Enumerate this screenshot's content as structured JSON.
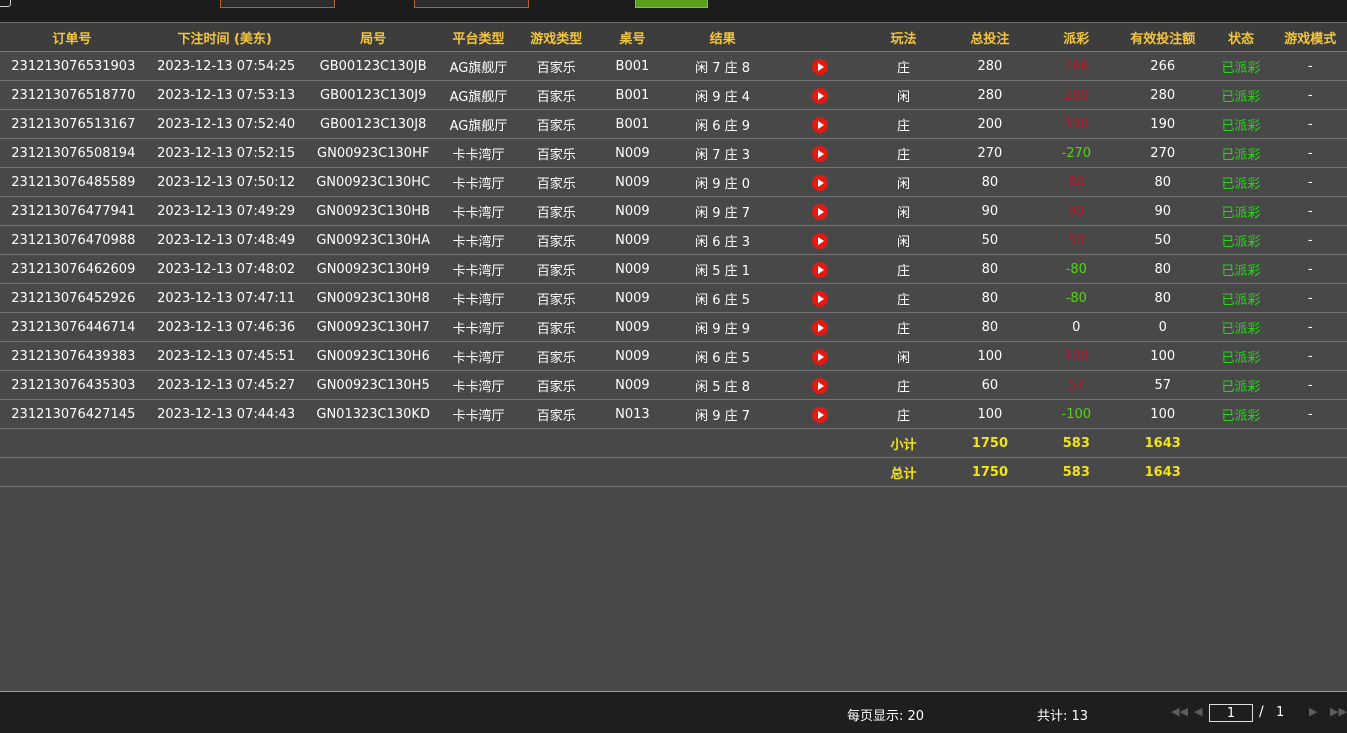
{
  "columns": [
    "订单号",
    "下注时间 (美东)",
    "局号",
    "平台类型",
    "游戏类型",
    "桌号",
    "结果",
    "",
    "玩法",
    "总投注",
    "派彩",
    "有效投注额",
    "状态",
    "游戏模式"
  ],
  "rows": [
    {
      "order": "231213076531903",
      "time": "2023-12-13 07:54:25",
      "round": "GB00123C130JB",
      "platform": "AG旗舰厅",
      "game": "百家乐",
      "table": "B001",
      "result": "闲 7 庄 8",
      "bet_type": "庄",
      "total": "280",
      "payout": "266",
      "payout_status": "loss",
      "valid": "266",
      "status": "已派彩",
      "mode": "-"
    },
    {
      "order": "231213076518770",
      "time": "2023-12-13 07:53:13",
      "round": "GB00123C130J9",
      "platform": "AG旗舰厅",
      "game": "百家乐",
      "table": "B001",
      "result": "闲 9 庄 4",
      "bet_type": "闲",
      "total": "280",
      "payout": "280",
      "payout_status": "loss",
      "valid": "280",
      "status": "已派彩",
      "mode": "-"
    },
    {
      "order": "231213076513167",
      "time": "2023-12-13 07:52:40",
      "round": "GB00123C130J8",
      "platform": "AG旗舰厅",
      "game": "百家乐",
      "table": "B001",
      "result": "闲 6 庄 9",
      "bet_type": "庄",
      "total": "200",
      "payout": "190",
      "payout_status": "loss",
      "valid": "190",
      "status": "已派彩",
      "mode": "-"
    },
    {
      "order": "231213076508194",
      "time": "2023-12-13 07:52:15",
      "round": "GN00923C130HF",
      "platform": "卡卡湾厅",
      "game": "百家乐",
      "table": "N009",
      "result": "闲 7 庄 3",
      "bet_type": "庄",
      "total": "270",
      "payout": "-270",
      "payout_status": "win",
      "valid": "270",
      "status": "已派彩",
      "mode": "-"
    },
    {
      "order": "231213076485589",
      "time": "2023-12-13 07:50:12",
      "round": "GN00923C130HC",
      "platform": "卡卡湾厅",
      "game": "百家乐",
      "table": "N009",
      "result": "闲 9 庄 0",
      "bet_type": "闲",
      "total": "80",
      "payout": "80",
      "payout_status": "loss",
      "valid": "80",
      "status": "已派彩",
      "mode": "-"
    },
    {
      "order": "231213076477941",
      "time": "2023-12-13 07:49:29",
      "round": "GN00923C130HB",
      "platform": "卡卡湾厅",
      "game": "百家乐",
      "table": "N009",
      "result": "闲 9 庄 7",
      "bet_type": "闲",
      "total": "90",
      "payout": "90",
      "payout_status": "loss",
      "valid": "90",
      "status": "已派彩",
      "mode": "-"
    },
    {
      "order": "231213076470988",
      "time": "2023-12-13 07:48:49",
      "round": "GN00923C130HA",
      "platform": "卡卡湾厅",
      "game": "百家乐",
      "table": "N009",
      "result": "闲 6 庄 3",
      "bet_type": "闲",
      "total": "50",
      "payout": "50",
      "payout_status": "loss",
      "valid": "50",
      "status": "已派彩",
      "mode": "-"
    },
    {
      "order": "231213076462609",
      "time": "2023-12-13 07:48:02",
      "round": "GN00923C130H9",
      "platform": "卡卡湾厅",
      "game": "百家乐",
      "table": "N009",
      "result": "闲 5 庄 1",
      "bet_type": "庄",
      "total": "80",
      "payout": "-80",
      "payout_status": "win",
      "valid": "80",
      "status": "已派彩",
      "mode": "-"
    },
    {
      "order": "231213076452926",
      "time": "2023-12-13 07:47:11",
      "round": "GN00923C130H8",
      "platform": "卡卡湾厅",
      "game": "百家乐",
      "table": "N009",
      "result": "闲 6 庄 5",
      "bet_type": "庄",
      "total": "80",
      "payout": "-80",
      "payout_status": "win",
      "valid": "80",
      "status": "已派彩",
      "mode": "-"
    },
    {
      "order": "231213076446714",
      "time": "2023-12-13 07:46:36",
      "round": "GN00923C130H7",
      "platform": "卡卡湾厅",
      "game": "百家乐",
      "table": "N009",
      "result": "闲 9 庄 9",
      "bet_type": "庄",
      "total": "80",
      "payout": "0",
      "payout_status": "neutral",
      "valid": "0",
      "status": "已派彩",
      "mode": "-"
    },
    {
      "order": "231213076439383",
      "time": "2023-12-13 07:45:51",
      "round": "GN00923C130H6",
      "platform": "卡卡湾厅",
      "game": "百家乐",
      "table": "N009",
      "result": "闲 6 庄 5",
      "bet_type": "闲",
      "total": "100",
      "payout": "100",
      "payout_status": "loss",
      "valid": "100",
      "status": "已派彩",
      "mode": "-"
    },
    {
      "order": "231213076435303",
      "time": "2023-12-13 07:45:27",
      "round": "GN00923C130H5",
      "platform": "卡卡湾厅",
      "game": "百家乐",
      "table": "N009",
      "result": "闲 5 庄 8",
      "bet_type": "庄",
      "total": "60",
      "payout": "57",
      "payout_status": "loss",
      "valid": "57",
      "status": "已派彩",
      "mode": "-"
    },
    {
      "order": "231213076427145",
      "time": "2023-12-13 07:44:43",
      "round": "GN01323C130KD",
      "platform": "卡卡湾厅",
      "game": "百家乐",
      "table": "N013",
      "result": "闲 9 庄 7",
      "bet_type": "庄",
      "total": "100",
      "payout": "-100",
      "payout_status": "win",
      "valid": "100",
      "status": "已派彩",
      "mode": "-"
    }
  ],
  "subtotal": {
    "label": "小计",
    "total": "1750",
    "payout": "583",
    "valid": "1643"
  },
  "grandtotal": {
    "label": "总计",
    "total": "1750",
    "payout": "583",
    "valid": "1643"
  },
  "pager": {
    "page_size_text": "每页显示: 20",
    "total_text": "共计: 13",
    "current_page": "1",
    "separator": "/",
    "page_count": "1",
    "nav_icons": [
      "first-page-icon",
      "prev-page-icon",
      "next-page-icon",
      "last-page-icon"
    ]
  },
  "colors": {
    "header_text": "#f2c53d",
    "loss": "#b8182a",
    "win": "#56d21c",
    "status": "#2ad51a",
    "summary": "#f3e417",
    "play_icon": "#e21a12"
  }
}
